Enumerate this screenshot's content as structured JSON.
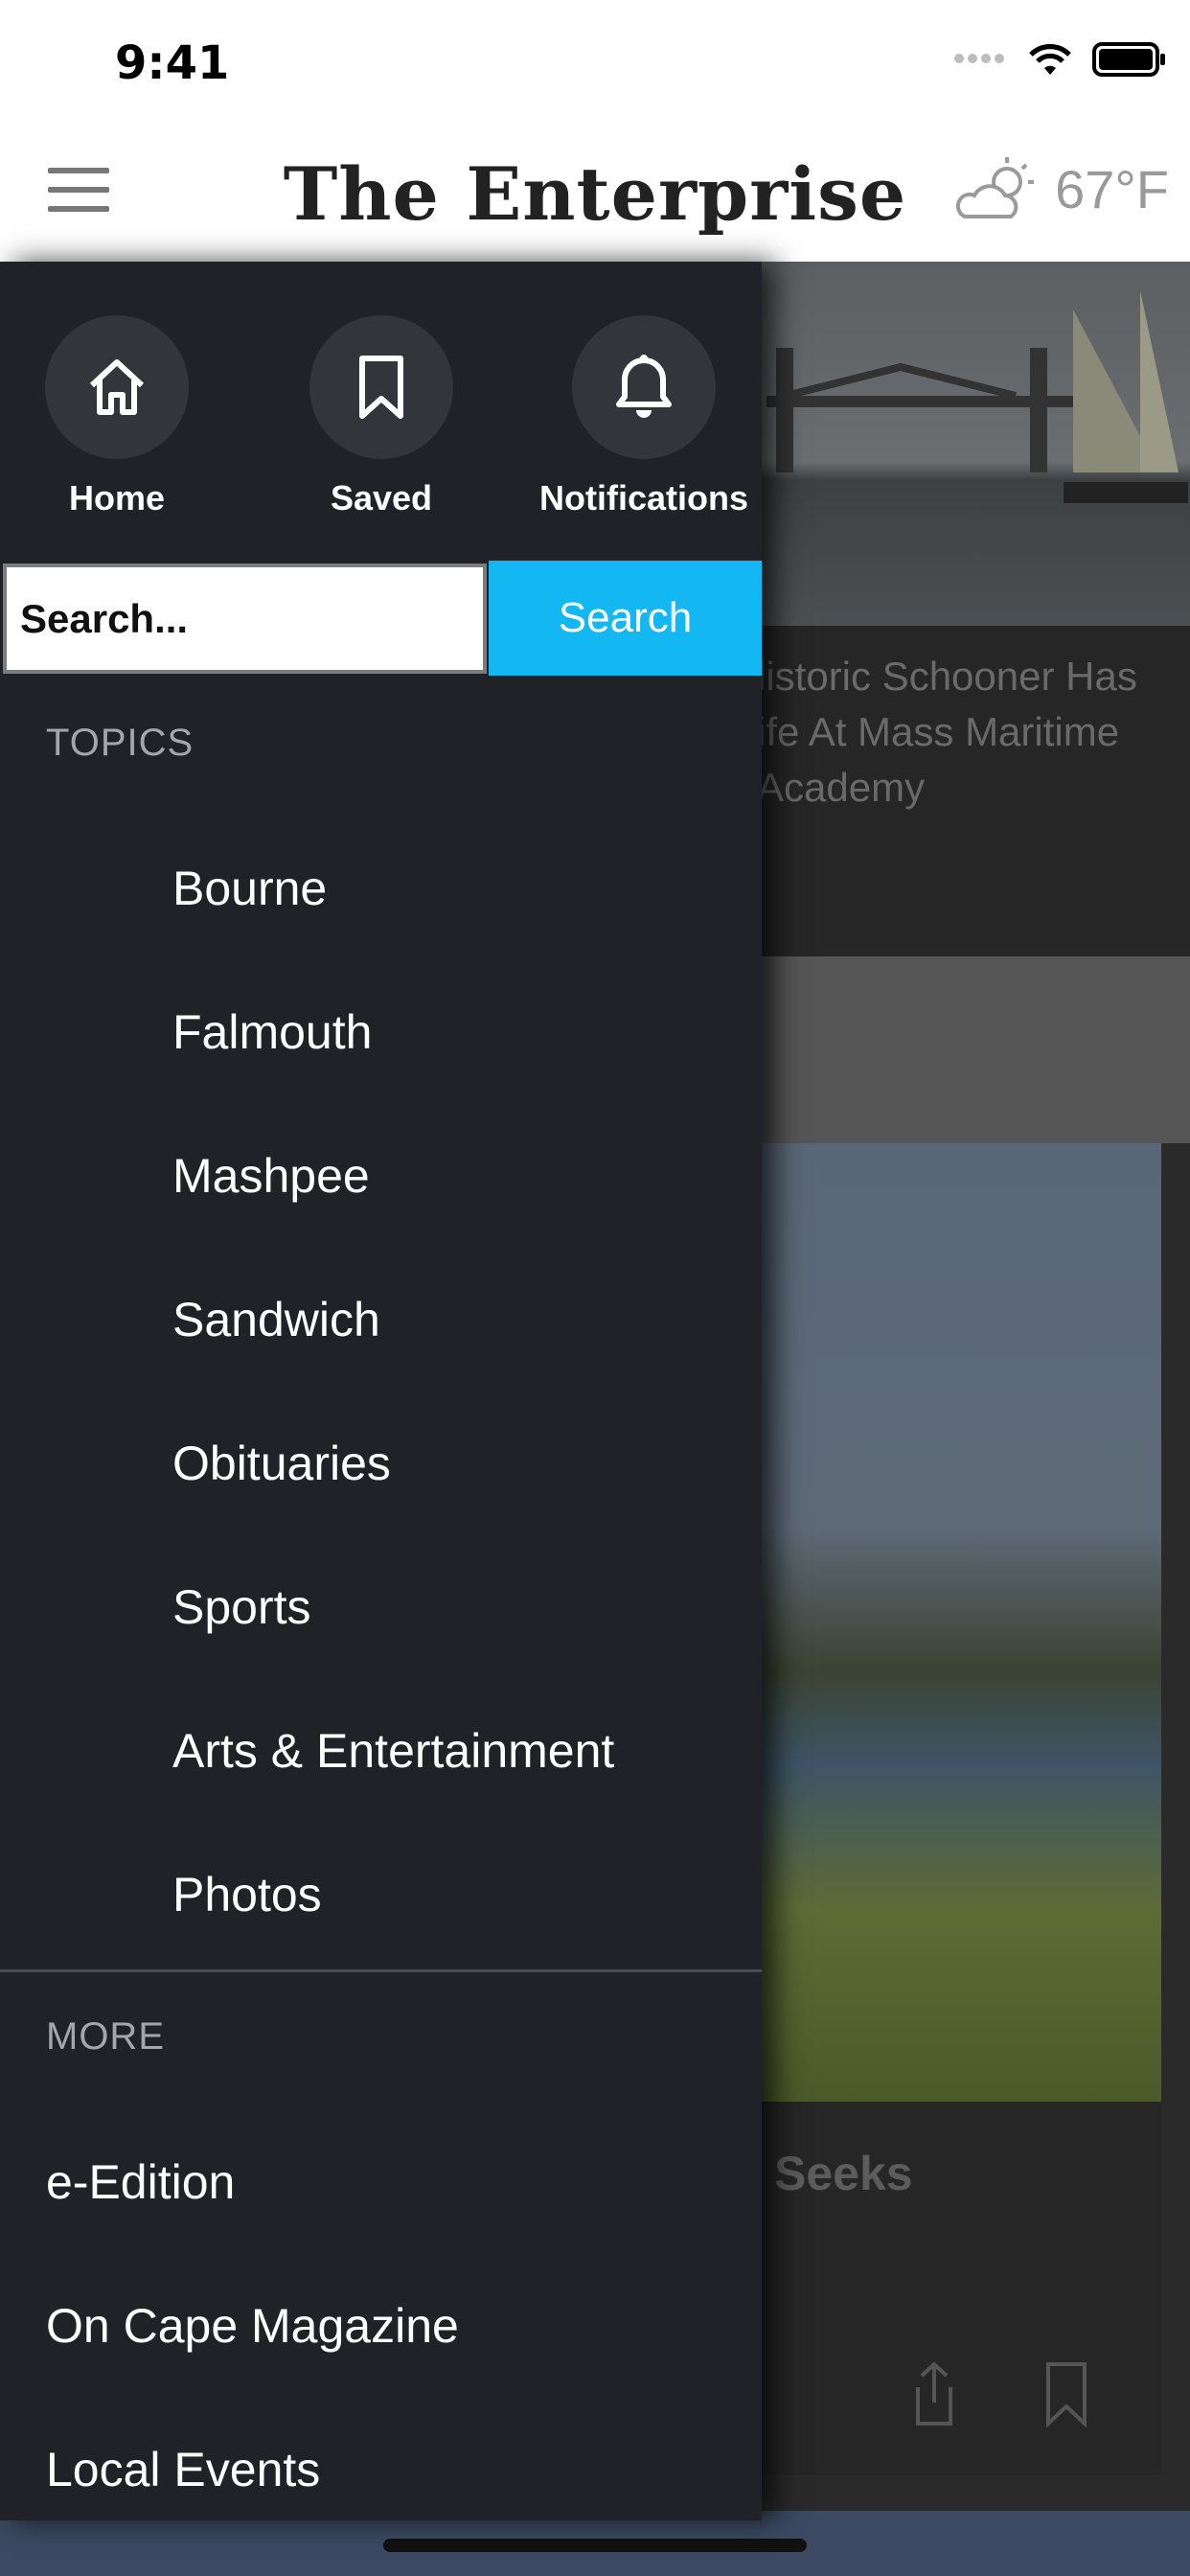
{
  "status_bar": {
    "time": "9:41"
  },
  "header": {
    "masthead": "The Enterprise",
    "temperature": "67°F",
    "weather_icon": "partly-cloudy-icon"
  },
  "drawer": {
    "quick_links": [
      {
        "label": "Home",
        "icon": "home-icon"
      },
      {
        "label": "Saved",
        "icon": "bookmark-icon"
      },
      {
        "label": "Notifications",
        "icon": "bell-icon"
      }
    ],
    "search": {
      "placeholder": "Search...",
      "button_label": "Search"
    },
    "topics_heading": "TOPICS",
    "topics": [
      "Bourne",
      "Falmouth",
      "Mashpee",
      "Sandwich",
      "Obituaries",
      "Sports",
      "Arts & Entertainment",
      "Photos"
    ],
    "more_heading": "MORE",
    "more": [
      "e-Edition",
      "On Cape Magazine",
      "Local Events"
    ]
  },
  "background": {
    "story1_title": "listoric Schooner Has\nife At Mass Maritime\nAcademy",
    "story2_title": "Seeks"
  },
  "colors": {
    "drawer_bg": "#212228",
    "search_button": "#13b7f2"
  }
}
